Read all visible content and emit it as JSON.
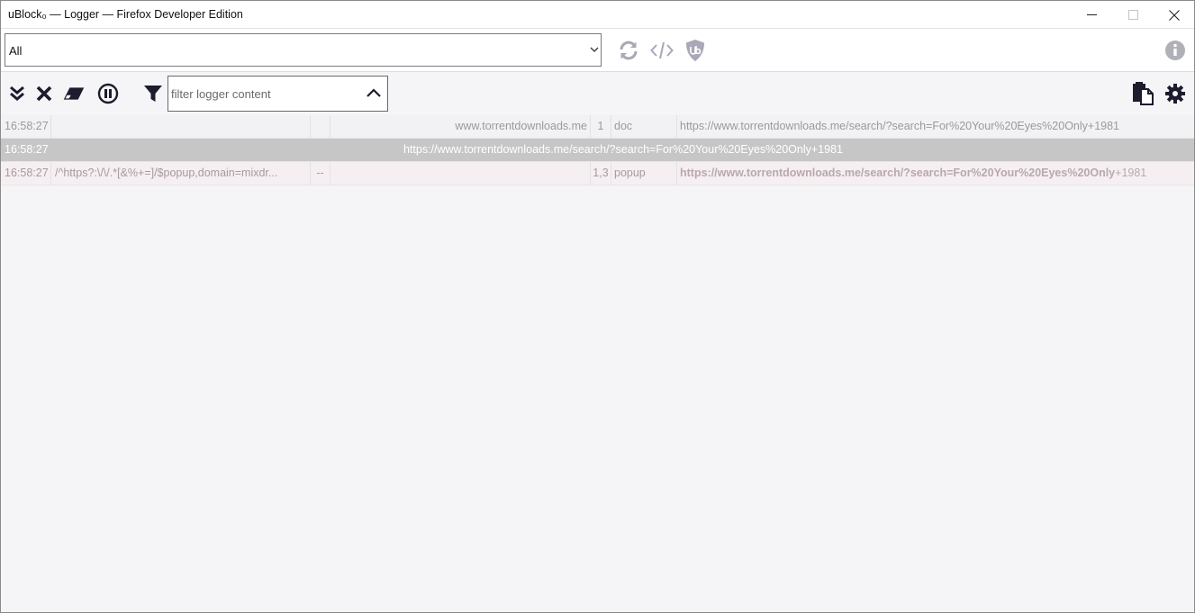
{
  "window": {
    "title": "uBlock₀ — Logger — Firefox Developer Edition"
  },
  "topbar": {
    "tab_selector_value": "All"
  },
  "toolbar": {
    "filter_placeholder": "filter logger content"
  },
  "log": {
    "rows": [
      {
        "time": "16:58:27",
        "filter": "",
        "flag": "",
        "context": "www.torrentdownloads.me",
        "party": "1",
        "type": "doc",
        "url": "https://www.torrentdownloads.me/search/?search=For%20Your%20Eyes%20Only+1981"
      },
      {
        "time": "16:58:27",
        "document_url": "https://www.torrentdownloads.me/search/?search=For%20Your%20Eyes%20Only+1981"
      },
      {
        "time": "16:58:27",
        "filter": "/^https?:\\/\\/.*[&%+=]/$popup,domain=mixdr...",
        "flag": "--",
        "context": "",
        "party": "1,3",
        "type": "popup",
        "url_match": "https://www.torrentdownloads.me/search/?search=For%20Your%20Eyes%20Only",
        "url_rest": "+1981"
      }
    ]
  },
  "colors": {
    "icon_dark": "#1c1c2e",
    "icon_muted": "#a8a8b8",
    "selected_row": "#c6c6c6",
    "blocked_row": "#f6eff1"
  }
}
